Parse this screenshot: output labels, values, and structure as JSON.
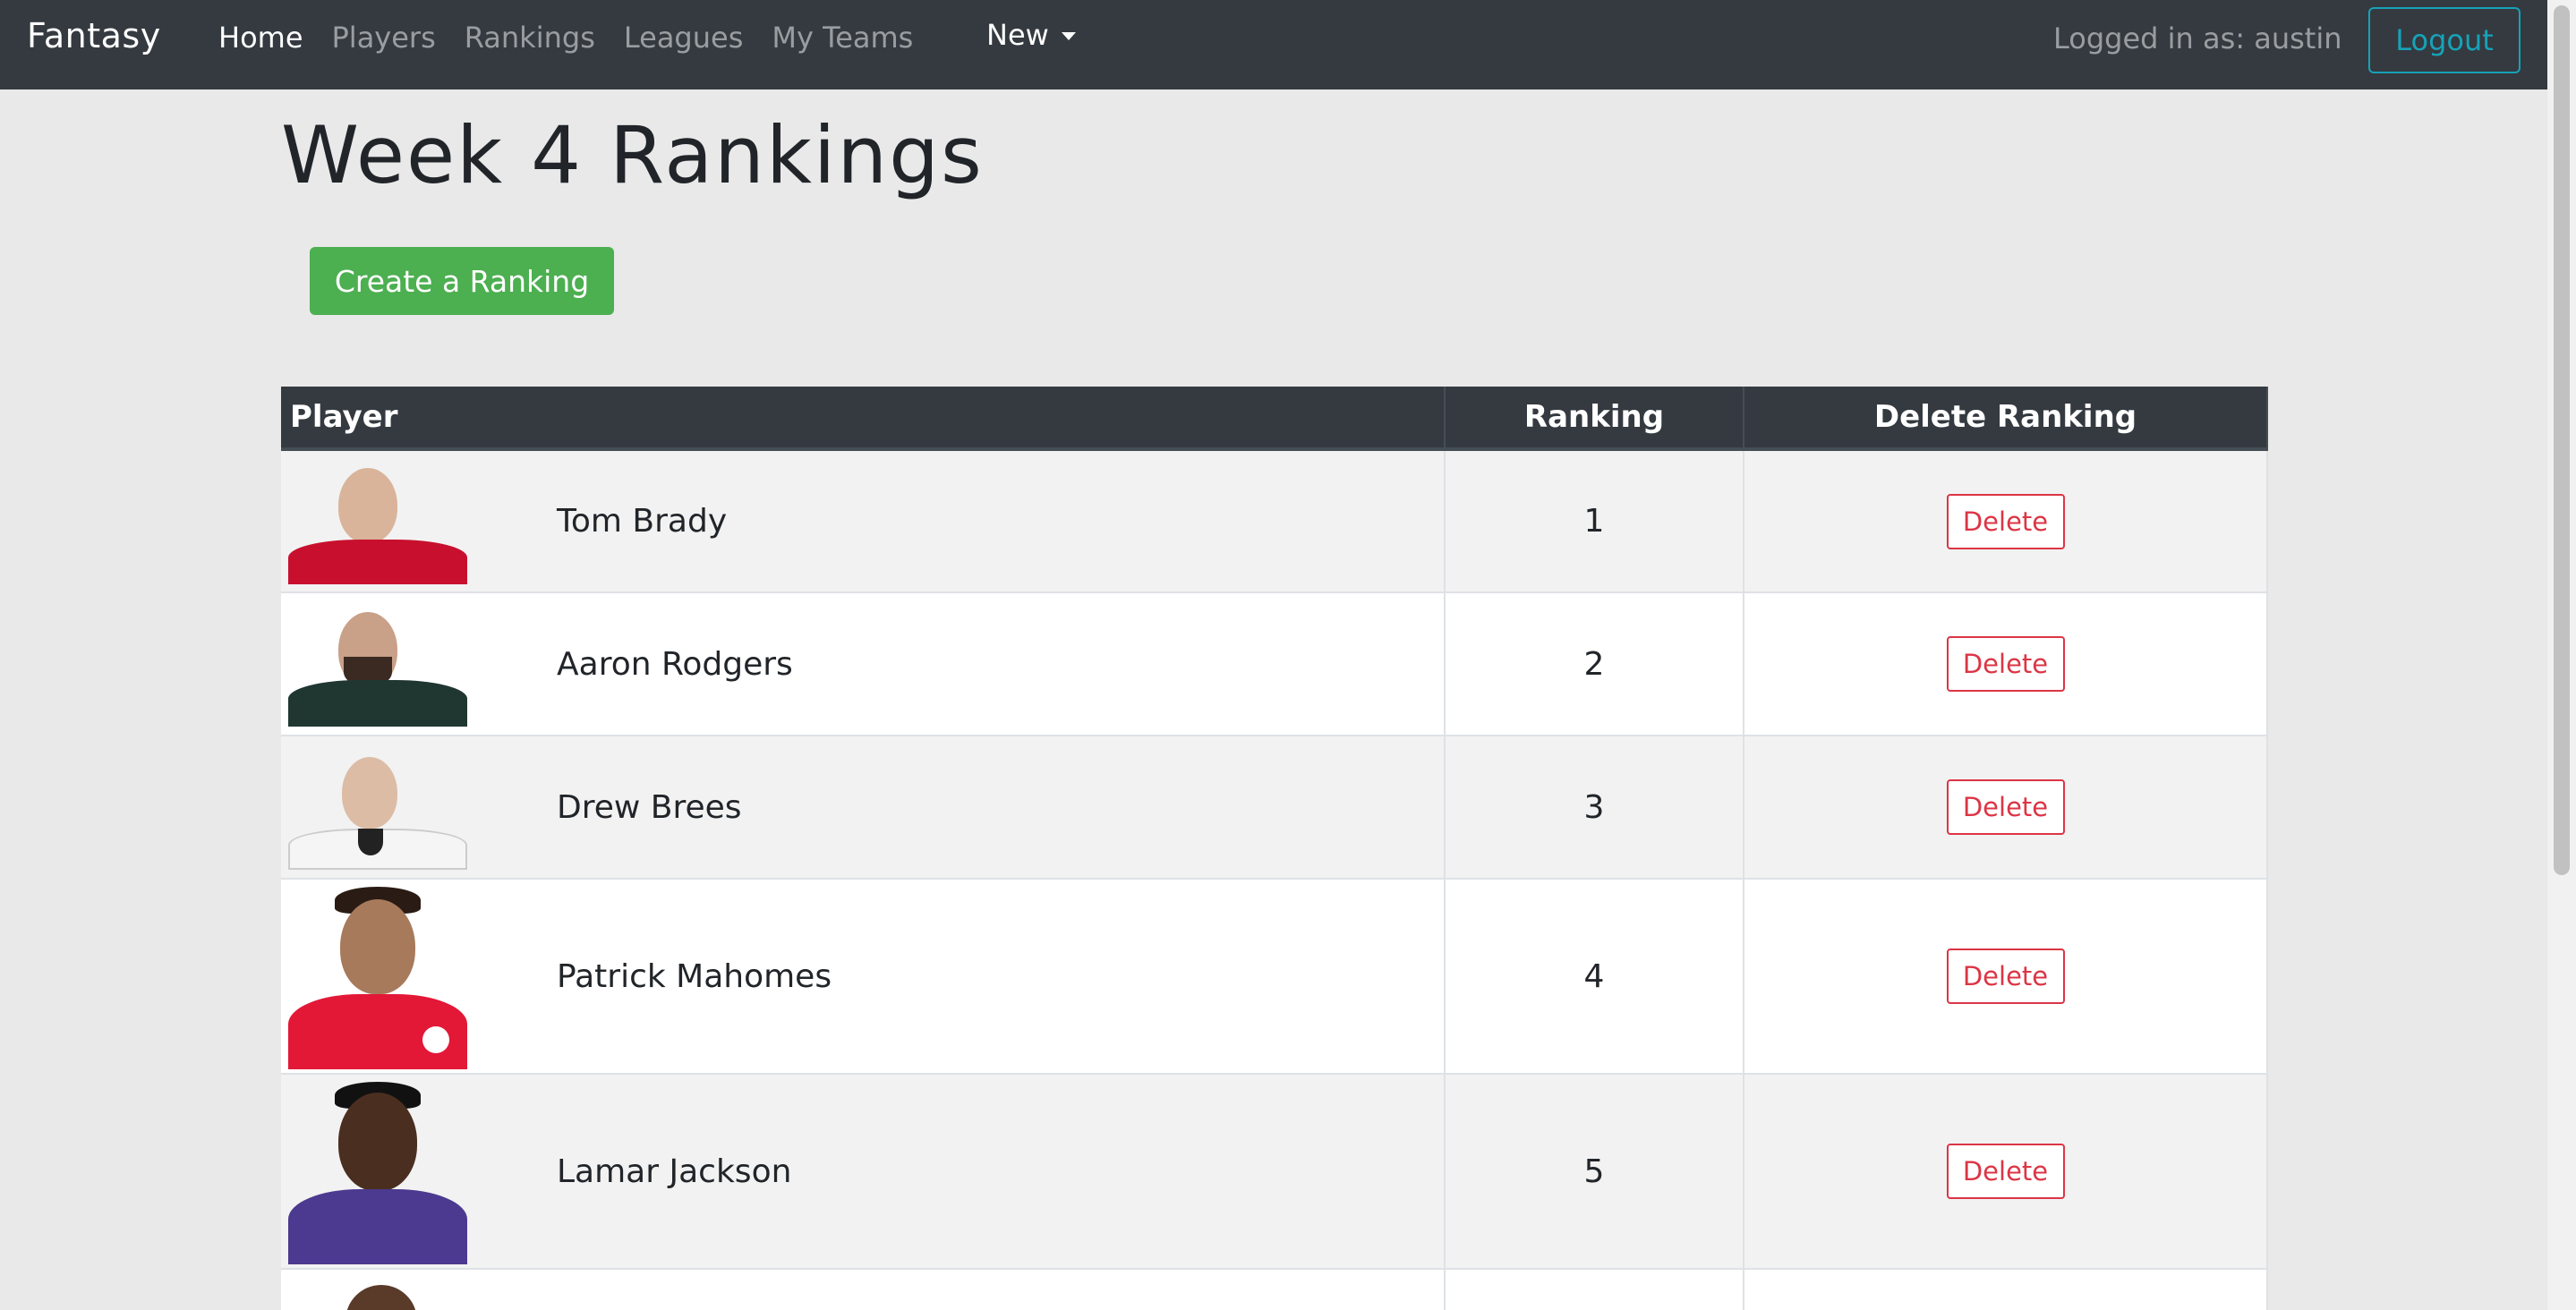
{
  "navbar": {
    "brand": "Fantasy",
    "links": [
      {
        "label": "Home",
        "active": true
      },
      {
        "label": "Players",
        "active": false
      },
      {
        "label": "Rankings",
        "active": false
      },
      {
        "label": "Leagues",
        "active": false
      },
      {
        "label": "My Teams",
        "active": false
      }
    ],
    "dropdown_label": "New",
    "logged_in_text": "Logged in as: austin",
    "logout_label": "Logout"
  },
  "page": {
    "title": "Week 4 Rankings",
    "create_button": "Create a Ranking"
  },
  "table": {
    "headers": {
      "player": "Player",
      "ranking": "Ranking",
      "delete": "Delete Ranking"
    },
    "rows": [
      {
        "name": "Tom Brady",
        "ranking": "1",
        "delete_label": "Delete",
        "jersey_color": "#c8102e"
      },
      {
        "name": "Aaron Rodgers",
        "ranking": "2",
        "delete_label": "Delete",
        "jersey_color": "#203731"
      },
      {
        "name": "Drew Brees",
        "ranking": "3",
        "delete_label": "Delete",
        "jersey_color": "#f5f5f5"
      },
      {
        "name": "Patrick Mahomes",
        "ranking": "4",
        "delete_label": "Delete",
        "jersey_color": "#e31837"
      },
      {
        "name": "Lamar Jackson",
        "ranking": "5",
        "delete_label": "Delete",
        "jersey_color": "#4b3a8f"
      }
    ]
  },
  "colors": {
    "navbar_bg": "#343a40",
    "create_button_bg": "#4caf50",
    "delete_red": "#dc3545",
    "logout_teal": "#17a2b8"
  }
}
